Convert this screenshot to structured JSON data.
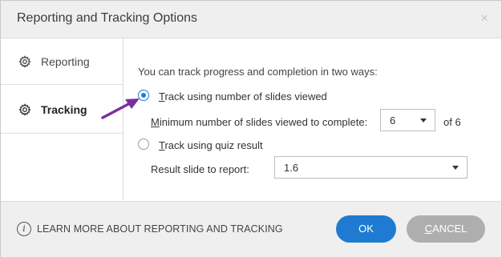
{
  "dialog": {
    "title": "Reporting and Tracking Options",
    "close_glyph": "×"
  },
  "sidebar": {
    "items": [
      {
        "label": "Reporting",
        "icon": "gear-icon",
        "selected": false
      },
      {
        "label": "Tracking",
        "icon": "gear-icon",
        "selected": true
      }
    ]
  },
  "tracking": {
    "intro": "You can track progress and completion in two ways:",
    "option_slides": {
      "first_letter": "T",
      "rest": "rack using number of slides viewed",
      "checked": true
    },
    "min_slides": {
      "first_letter": "M",
      "rest": "inimum number of slides viewed to complete:",
      "value": "6",
      "suffix": "of 6"
    },
    "option_quiz": {
      "first_letter": "T",
      "rest": "rack using quiz result",
      "checked": false
    },
    "result_slide": {
      "label": "Result slide to report:",
      "value": "1.6"
    }
  },
  "footer": {
    "info_glyph": "i",
    "learn_more": "LEARN MORE ABOUT REPORTING AND TRACKING",
    "ok_label": "OK",
    "cancel": {
      "first_letter": "C",
      "rest": "ANCEL"
    }
  },
  "colors": {
    "accent": "#1f7bd1",
    "arrow": "#7b2f9e",
    "cancel_bg": "#aeaeae",
    "chrome_bg": "#efefef"
  }
}
